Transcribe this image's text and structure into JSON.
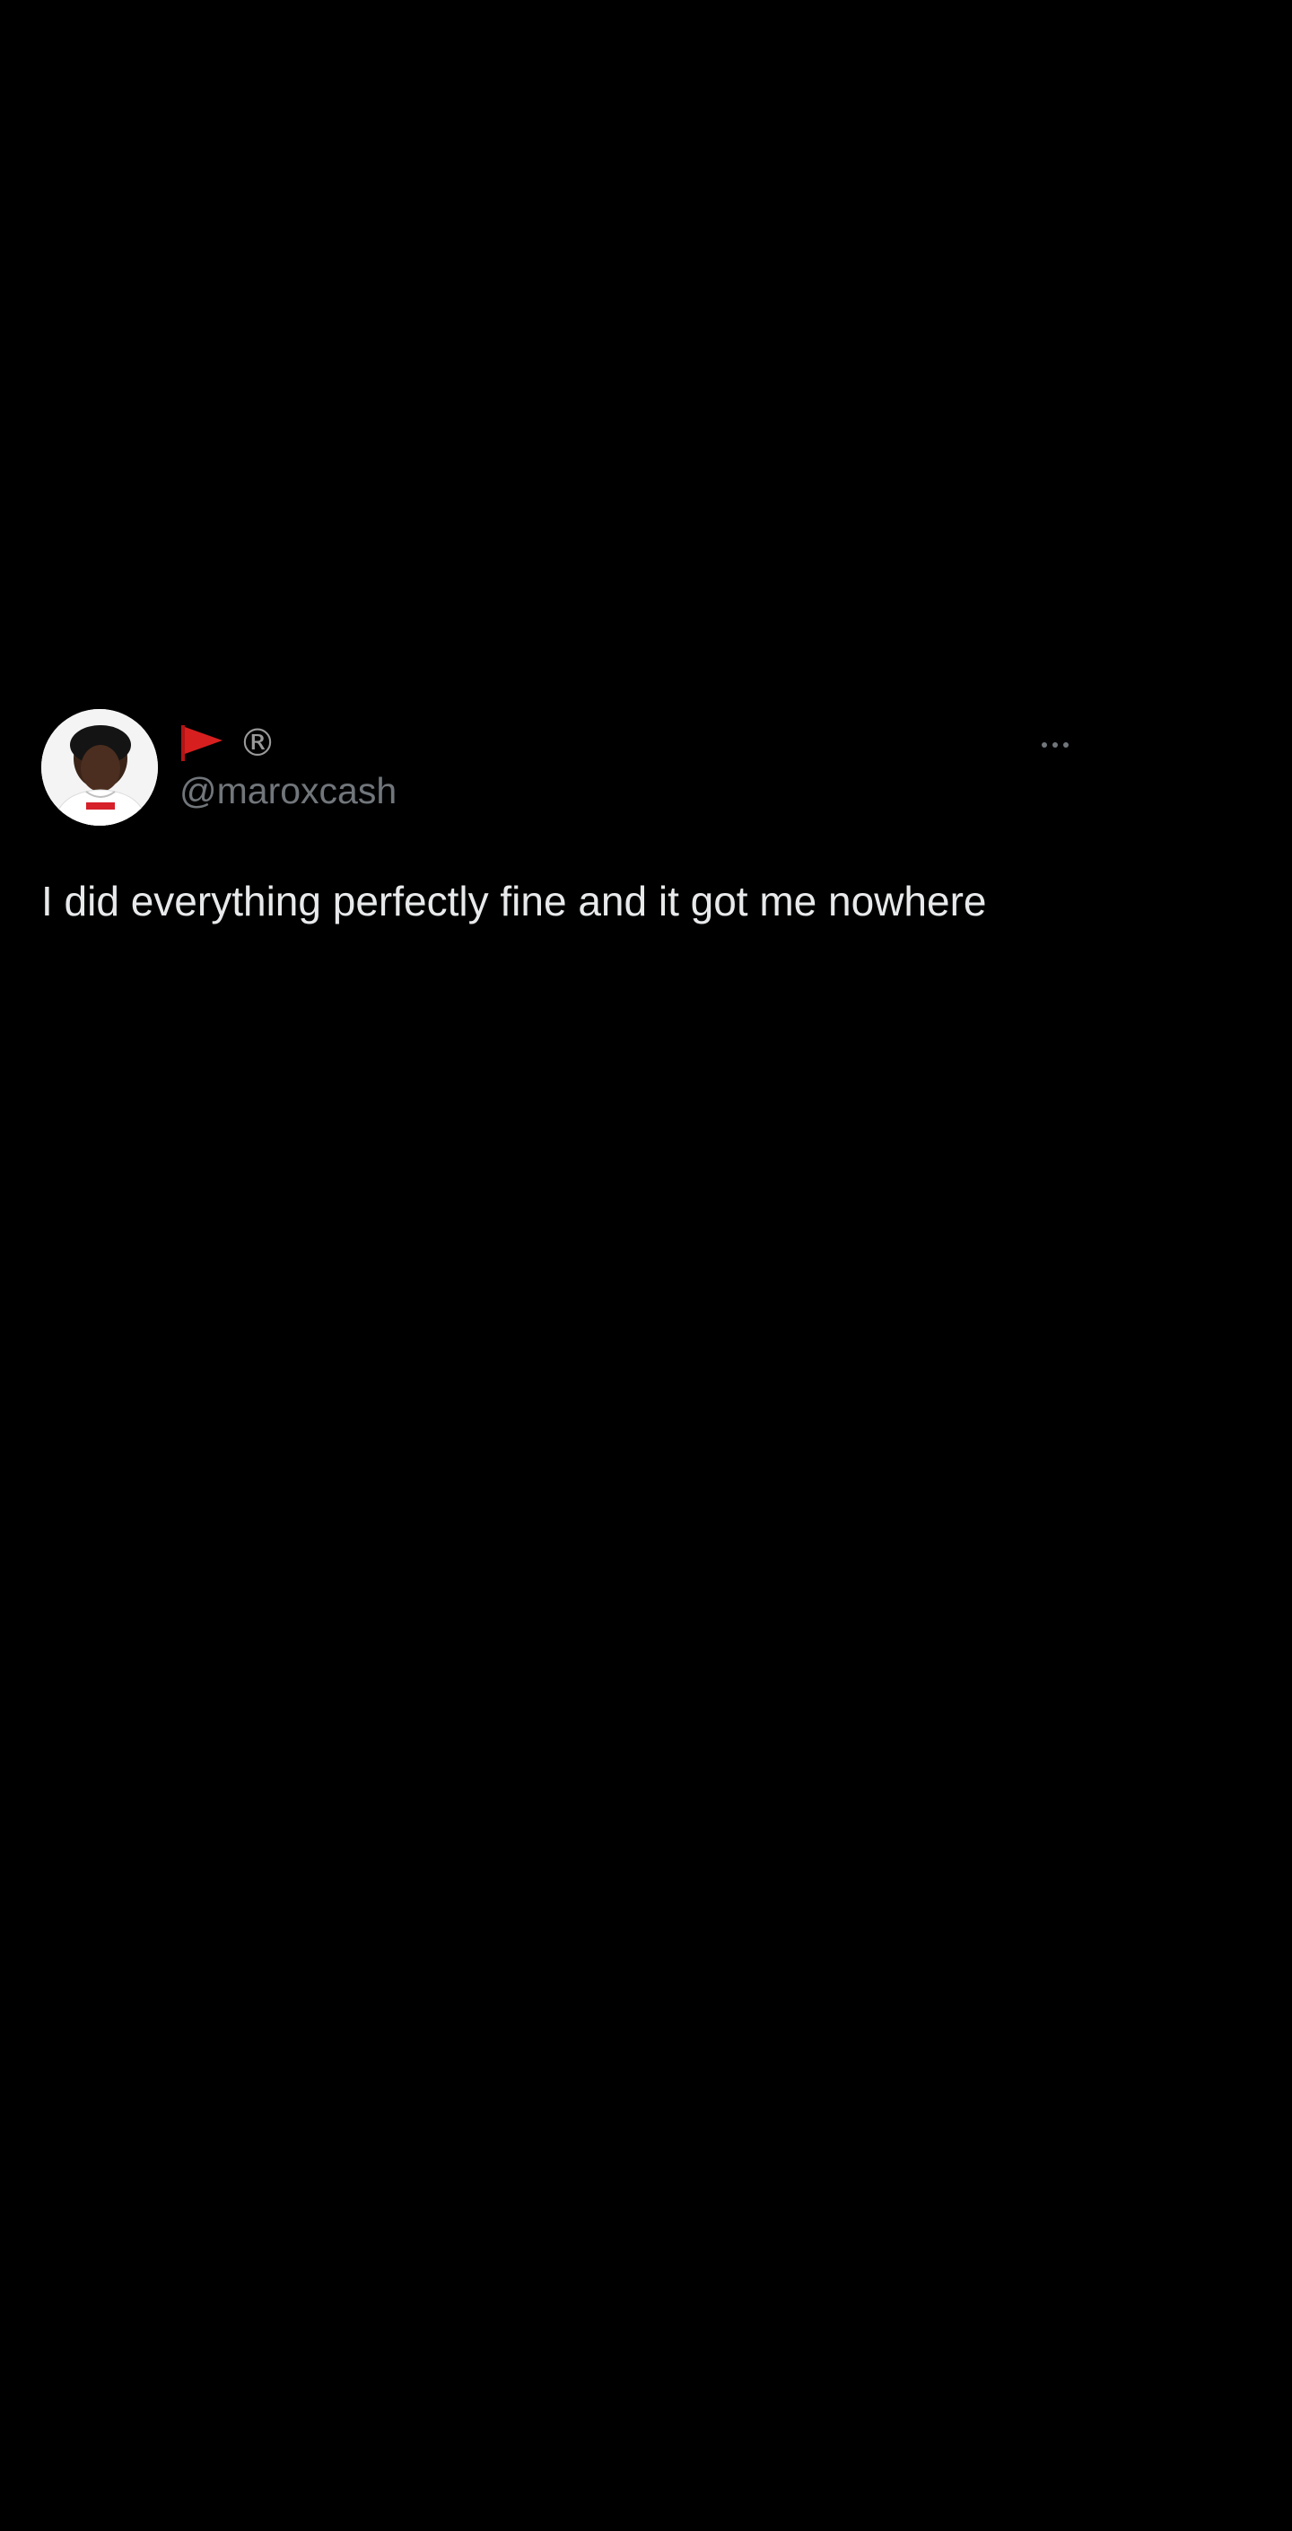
{
  "tweet": {
    "author": {
      "display_name_icons": [
        "red-flag-icon",
        "registered-icon"
      ],
      "registered_symbol": "®",
      "handle": "@maroxcash",
      "avatar_icon": "profile-avatar-icon"
    },
    "text": "I did everything perfectly fine and it got me nowhere",
    "more_icon": "more-options-icon"
  },
  "colors": {
    "background": "#000000",
    "text": "#e7e9ea",
    "secondary_text": "#71767b",
    "flag": "#d81f1f"
  }
}
